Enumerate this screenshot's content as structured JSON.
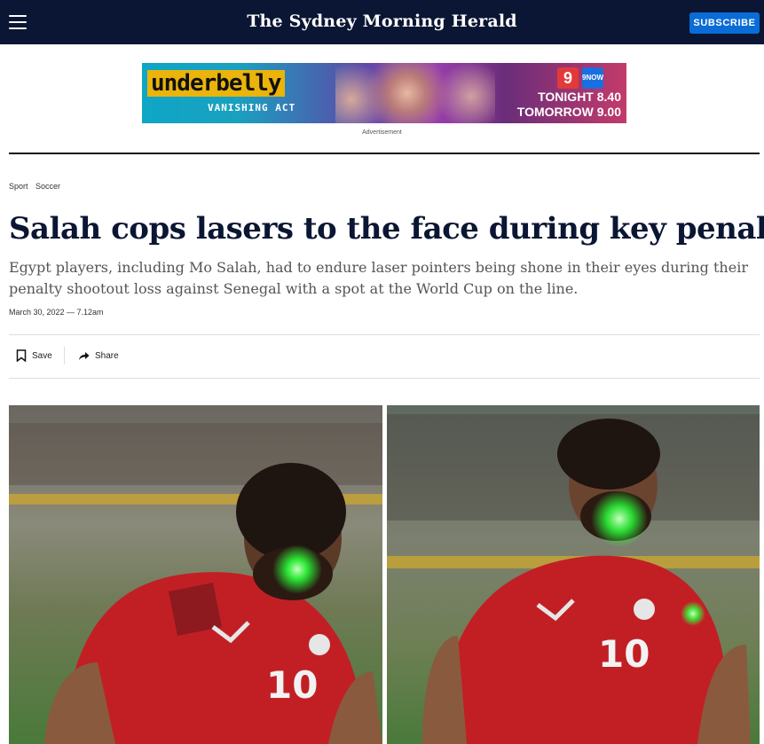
{
  "header": {
    "menu_icon": "hamburger-menu-icon",
    "masthead": "The Sydney Morning Herald",
    "subscribe_label": "SUBSCRIBE"
  },
  "ad": {
    "brand_line1": "underbelly",
    "brand_line2": "VANISHING ACT",
    "channel1": "9",
    "channel2": "9NOW",
    "tonight": "TONIGHT 8.40",
    "tomorrow": "TOMORROW 9.00",
    "label": "Advertisement"
  },
  "breadcrumb": {
    "items": [
      "Sport",
      "Soccer"
    ]
  },
  "article": {
    "headline": "Salah cops lasers to the face during key penalty",
    "standfirst": "Egypt players, including Mo Salah, had to endure laser pointers being shone in their eyes during their penalty shootout loss against Senegal with a spot at the World Cup on the line.",
    "date": "March 30, 2022 — 7.12am"
  },
  "tools": {
    "save_label": "Save",
    "save_icon": "bookmark-icon",
    "share_label": "Share",
    "share_icon": "share-arrow-icon"
  },
  "photo": {
    "left_number": "10",
    "right_number": "10",
    "colors": {
      "jersey": "#c21f25",
      "laser": "#2dff3a",
      "pitch": "#4a7a3a"
    }
  },
  "colors": {
    "header_bg": "#0a1633",
    "subscribe_bg": "#0a6cd6",
    "headline": "#0a1633"
  }
}
